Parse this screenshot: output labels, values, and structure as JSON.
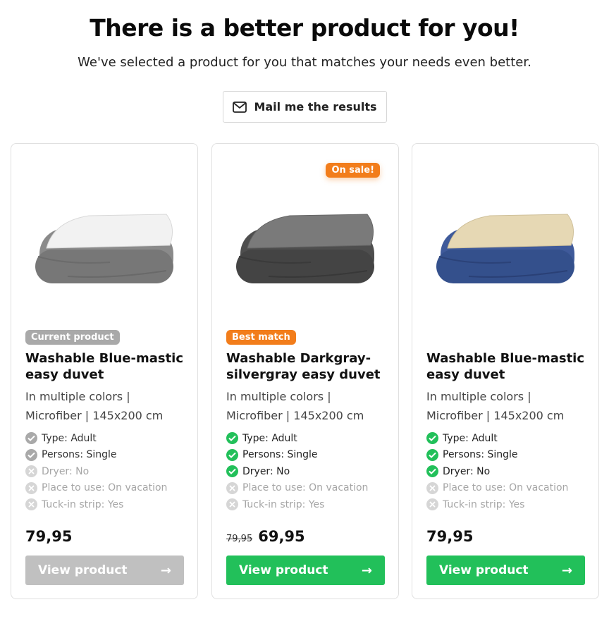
{
  "header": {
    "title": "There is a better product for you!",
    "subtitle": "We've selected a product for you that matches your needs even better."
  },
  "mail_button": {
    "label": "Mail me the results",
    "icon": "envelope-icon"
  },
  "colors": {
    "accent_green": "#22c05a",
    "sale_orange": "#f27d1b",
    "muted_grey": "#a9a9a9"
  },
  "products": [
    {
      "tag": "Current product",
      "name": "Washable Blue-mastic easy duvet",
      "description": "In multiple colors | Microfiber | 145x200 cm",
      "features": [
        {
          "text": "Type: Adult",
          "state": "muted"
        },
        {
          "text": "Persons: Single",
          "state": "muted"
        },
        {
          "text": "Dryer: No",
          "state": "off"
        },
        {
          "text": "Place to use: On vacation",
          "state": "off"
        },
        {
          "text": "Tuck-in strip: Yes",
          "state": "off"
        }
      ],
      "price": "79,95",
      "button_label": "View product",
      "arrow": "→"
    },
    {
      "sale_badge": "On sale!",
      "tag": "Best match",
      "name": "Washable Darkgray-silvergray easy duvet",
      "description": "In multiple colors | Microfiber | 145x200 cm",
      "features": [
        {
          "text": "Type: Adult",
          "state": "on"
        },
        {
          "text": "Persons: Single",
          "state": "on"
        },
        {
          "text": "Dryer: No",
          "state": "on"
        },
        {
          "text": "Place to use: On vacation",
          "state": "off"
        },
        {
          "text": "Tuck-in strip: Yes",
          "state": "off"
        }
      ],
      "old_price": "79,95",
      "price": "69,95",
      "button_label": "View product",
      "arrow": "→"
    },
    {
      "name": "Washable Blue-mastic easy duvet",
      "description": "In multiple colors | Microfiber | 145x200 cm",
      "features": [
        {
          "text": "Type: Adult",
          "state": "on"
        },
        {
          "text": "Persons: Single",
          "state": "on"
        },
        {
          "text": "Dryer: No",
          "state": "on"
        },
        {
          "text": "Place to use: On vacation",
          "state": "off"
        },
        {
          "text": "Tuck-in strip: Yes",
          "state": "off"
        }
      ],
      "price": "79,95",
      "button_label": "View product",
      "arrow": "→"
    }
  ]
}
